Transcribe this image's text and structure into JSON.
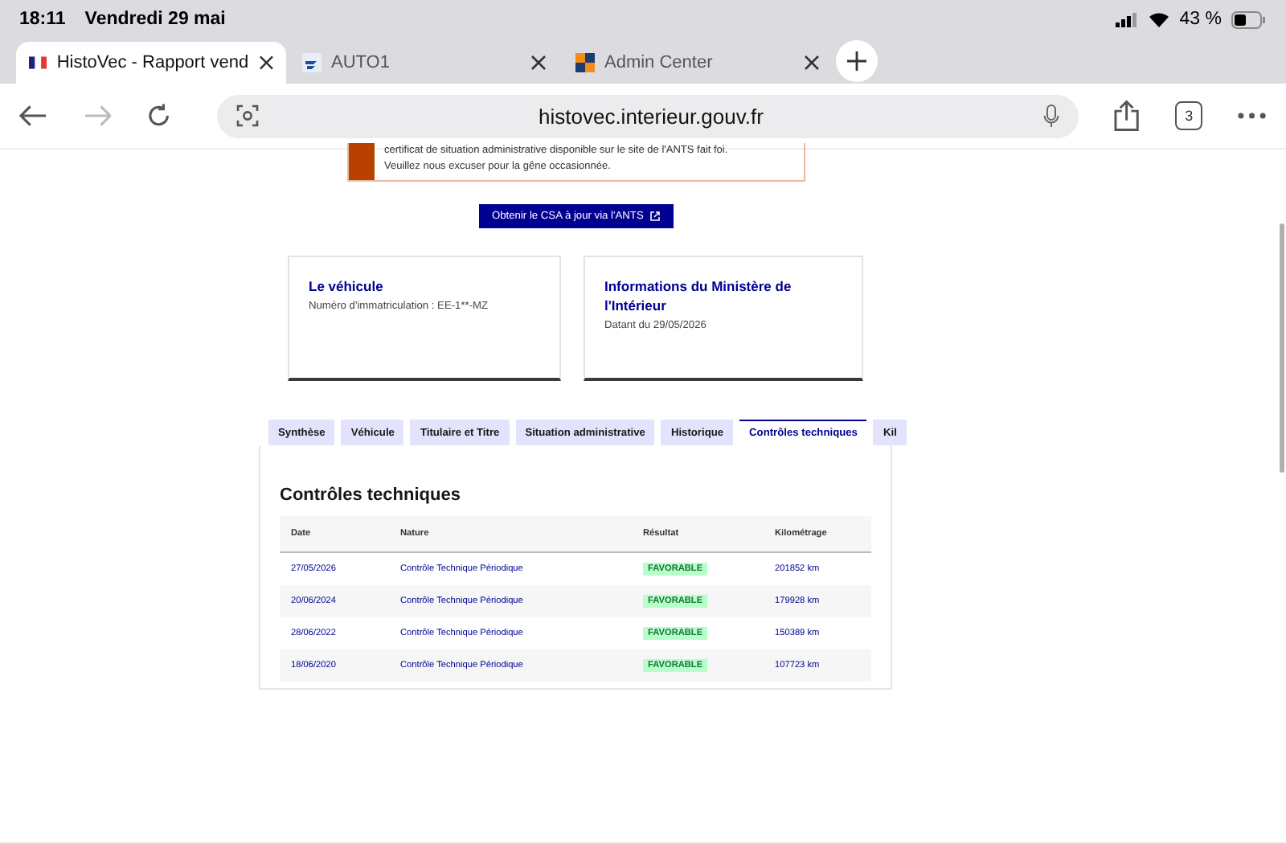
{
  "status_bar": {
    "time": "18:11",
    "date": "Vendredi 29 mai",
    "battery": "43 %"
  },
  "browser_tabs": [
    {
      "title": "HistoVec - Rapport vend",
      "selected": true
    },
    {
      "title": "AUTO1",
      "selected": false
    },
    {
      "title": "Admin Center",
      "selected": false
    }
  ],
  "address_bar": {
    "url": "histovec.interieur.gouv.fr",
    "tab_count": "3"
  },
  "alert": {
    "lines": [
      "certificat de situation administrative disponible sur le site de l'ANTS fait foi.",
      "Veuillez nous excuser pour la gêne occasionnée."
    ]
  },
  "csa_button": "Obtenir le CSA à jour via l'ANTS",
  "cards": [
    {
      "title": "Le véhicule",
      "lines": [
        "Numéro d'immatriculation : EE-1**-MZ"
      ]
    },
    {
      "title": "Informations du Ministère de l'Intérieur",
      "lines": [
        "Datant du 29/05/2026"
      ]
    }
  ],
  "tabs": [
    {
      "label": "Synthèse",
      "selected": false
    },
    {
      "label": "Véhicule",
      "selected": false
    },
    {
      "label": "Titulaire et Titre",
      "selected": false
    },
    {
      "label": "Situation administrative",
      "selected": false
    },
    {
      "label": "Historique",
      "selected": false
    },
    {
      "label": "Contrôles techniques",
      "selected": true
    },
    {
      "label": "Kil",
      "selected": false
    }
  ],
  "section_title": "Contrôles techniques",
  "table": {
    "columns": [
      "Date",
      "Nature",
      "Résultat",
      "Kilométrage"
    ],
    "rows": [
      {
        "date": "27/05/2026",
        "nature": "Contrôle Technique Périodique",
        "result": "FAVORABLE",
        "km": "201852 km"
      },
      {
        "date": "20/06/2024",
        "nature": "Contrôle Technique Périodique",
        "result": "FAVORABLE",
        "km": "179928 km"
      },
      {
        "date": "28/06/2022",
        "nature": "Contrôle Technique Périodique",
        "result": "FAVORABLE",
        "km": "150389 km"
      },
      {
        "date": "18/06/2020",
        "nature": "Contrôle Technique Périodique",
        "result": "FAVORABLE",
        "km": "107723 km"
      }
    ]
  }
}
